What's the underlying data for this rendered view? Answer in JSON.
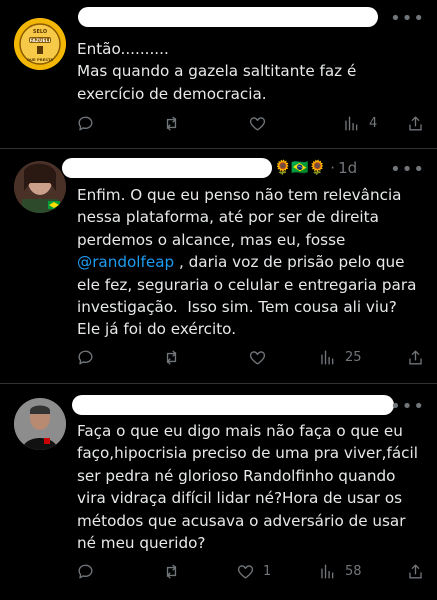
{
  "tweets": [
    {
      "name": "",
      "handle": "",
      "time": "",
      "lines": [
        "Então..........",
        "Mas quando a gazela saltitante faz é",
        "exercício de democracia."
      ],
      "actions": {
        "replies": "",
        "retweets": "",
        "likes": "",
        "views": "4"
      },
      "avatar": {
        "badge_top": "SELO",
        "badge_mid": "FAZUELI",
        "badge_bottom": "QUE PRESTA",
        "color": "#f0b400"
      }
    },
    {
      "name": "",
      "handle": "",
      "flags": "🌻🇧🇷🌻",
      "time": "1d",
      "line1": "Enfim. O que eu penso não tem relevância",
      "line2": "nessa plataforma, até por ser de direita",
      "line3": "perdemos o alcance, mas eu, fosse",
      "mention": "@randolfeap",
      "line4_rest": " , daria voz de prisão pelo que",
      "line5": "ele fez, seguraria o celular e entregaria para",
      "line6": "investigação.  Isso sim. Tem cousa ali viu?",
      "line7": "Ele já foi do exército.",
      "actions": {
        "replies": "",
        "retweets": "",
        "likes": "",
        "views": "25"
      }
    },
    {
      "name": "",
      "handle": "",
      "time": "",
      "lines": [
        "Faça o que eu digo mais não faça o que eu",
        "faço,hipocrisia preciso de uma pra viver,fácil",
        "ser pedra né glorioso Randolfinho quando",
        "vira vidraça difícil lidar né?Hora de usar os",
        "métodos que acusava o adversário de usar",
        "né meu querido?"
      ],
      "actions": {
        "replies": "",
        "retweets": "",
        "likes": "1",
        "views": "58"
      }
    }
  ],
  "more_icon": "more-dots-icon"
}
